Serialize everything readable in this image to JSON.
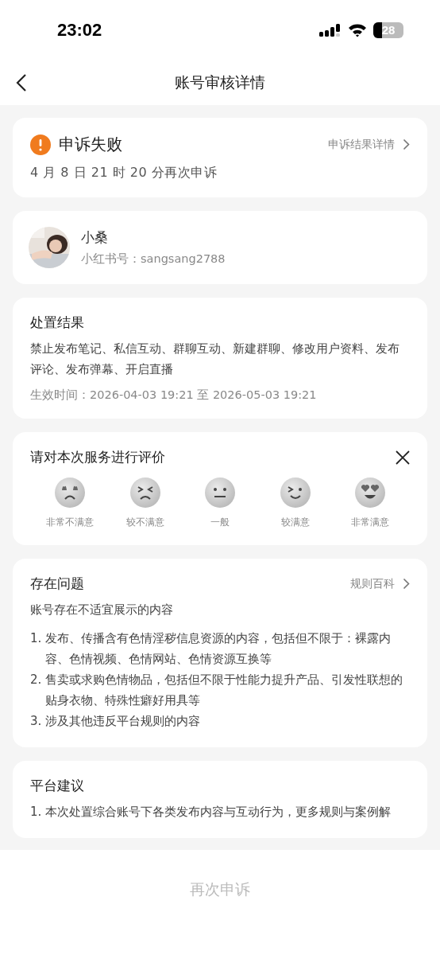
{
  "status_bar": {
    "time": "23:02",
    "battery": "28"
  },
  "nav": {
    "title": "账号审核详情"
  },
  "appeal": {
    "status": "申诉失败",
    "link": "申诉结果详情",
    "note": "4 月 8 日 21 时 20 分再次申诉"
  },
  "user": {
    "name": "小桑",
    "id": "小红书号：sangsang2788"
  },
  "result": {
    "title": "处置结果",
    "text": "禁止发布笔记、私信互动、群聊互动、新建群聊、修改用户资料、发布评论、发布弹幕、开启直播",
    "effective": "生效时间：2026-04-03 19:21 至 2026-05-03 19:21"
  },
  "rating": {
    "title": "请对本次服务进行评价",
    "options": [
      {
        "kind": "furious",
        "label": "非常不满意"
      },
      {
        "kind": "upset",
        "label": "较不满意"
      },
      {
        "kind": "neutral",
        "label": "一般"
      },
      {
        "kind": "smile",
        "label": "较满意"
      },
      {
        "kind": "love",
        "label": "非常满意"
      }
    ]
  },
  "problems": {
    "title": "存在问题",
    "link": "规则百科",
    "summary": "账号存在不适宜展示的内容",
    "items": [
      {
        "number": "1.",
        "text": "发布、传播含有色情淫秽信息资源的内容，包括但不限于：裸露内容、色情视频、色情网站、色情资源互换等"
      },
      {
        "number": "2.",
        "text": "售卖或求购色情物品，包括但不限于性能力提升产品、引发性联想的贴身衣物、特殊性癖好用具等"
      },
      {
        "number": "3.",
        "text": "涉及其他违反平台规则的内容"
      }
    ]
  },
  "advice": {
    "title": "平台建议",
    "items": [
      {
        "number": "1.",
        "text": "本次处置综合账号下各类发布内容与互动行为，更多规则与案例解"
      }
    ]
  },
  "footer": {
    "button": "再次申诉",
    "disabled": true
  }
}
